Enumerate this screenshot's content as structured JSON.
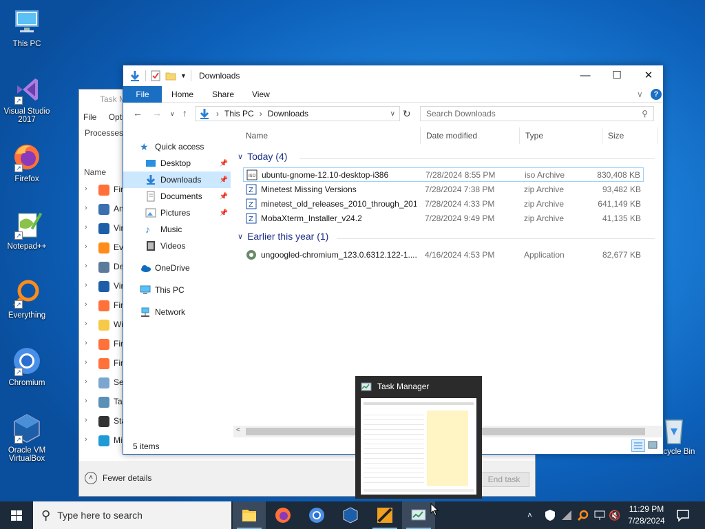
{
  "desktop": {
    "icons": [
      {
        "label": "This PC"
      },
      {
        "label": "Visual Studio 2017"
      },
      {
        "label": "Firefox"
      },
      {
        "label": "Notepad++"
      },
      {
        "label": "Everything"
      },
      {
        "label": "Chromium"
      },
      {
        "label": "Oracle VM VirtualBox"
      },
      {
        "label": "Recycle Bin"
      }
    ]
  },
  "taskmgr_bg": {
    "title": "Task M",
    "menu": [
      "File",
      "Optio"
    ],
    "tab": "Processes",
    "col_name": "Name",
    "rows": [
      "Fir",
      "An",
      "Vir",
      "Ev",
      "De",
      "Vir",
      "Fir",
      "Wi",
      "Fir",
      "Fir",
      "Se",
      "Ta",
      "Sta",
      "Mi"
    ],
    "fewer_details": "Fewer details",
    "end_task": "End task"
  },
  "explorer": {
    "title": "Downloads",
    "ribbon": {
      "file": "File",
      "home": "Home",
      "share": "Share",
      "view": "View"
    },
    "address": {
      "this_pc": "This PC",
      "downloads": "Downloads"
    },
    "search_placeholder": "Search Downloads",
    "nav": {
      "quick_access": "Quick access",
      "desktop": "Desktop",
      "downloads": "Downloads",
      "documents": "Documents",
      "pictures": "Pictures",
      "music": "Music",
      "videos": "Videos",
      "onedrive": "OneDrive",
      "this_pc": "This PC",
      "network": "Network"
    },
    "columns": {
      "name": "Name",
      "date": "Date modified",
      "type": "Type",
      "size": "Size"
    },
    "groups": {
      "today": "Today (4)",
      "earlier": "Earlier this year (1)"
    },
    "files": [
      {
        "name": "ubuntu-gnome-12.10-desktop-i386",
        "date": "7/28/2024 8:55 PM",
        "type": "iso Archive",
        "size": "830,408 KB"
      },
      {
        "name": "Minetest Missing Versions",
        "date": "7/28/2024 7:38 PM",
        "type": "zip Archive",
        "size": "93,482 KB"
      },
      {
        "name": "minetest_old_releases_2010_through_201...",
        "date": "7/28/2024 4:33 PM",
        "type": "zip Archive",
        "size": "641,149 KB"
      },
      {
        "name": "MobaXterm_Installer_v24.2",
        "date": "7/28/2024 9:49 PM",
        "type": "zip Archive",
        "size": "41,135 KB"
      },
      {
        "name": "ungoogled-chromium_123.0.6312.122-1....",
        "date": "4/16/2024 4:53 PM",
        "type": "Application",
        "size": "82,677 KB"
      }
    ],
    "status": "5 items"
  },
  "thumbnail": {
    "title": "Task Manager"
  },
  "taskbar": {
    "search_placeholder": "Type here to search",
    "time": "11:29 PM",
    "date": "7/28/2024"
  },
  "colors": {
    "accent": "#1a6fc2",
    "selection": "#cce8ff",
    "taskbar": "#1c2a3a"
  }
}
